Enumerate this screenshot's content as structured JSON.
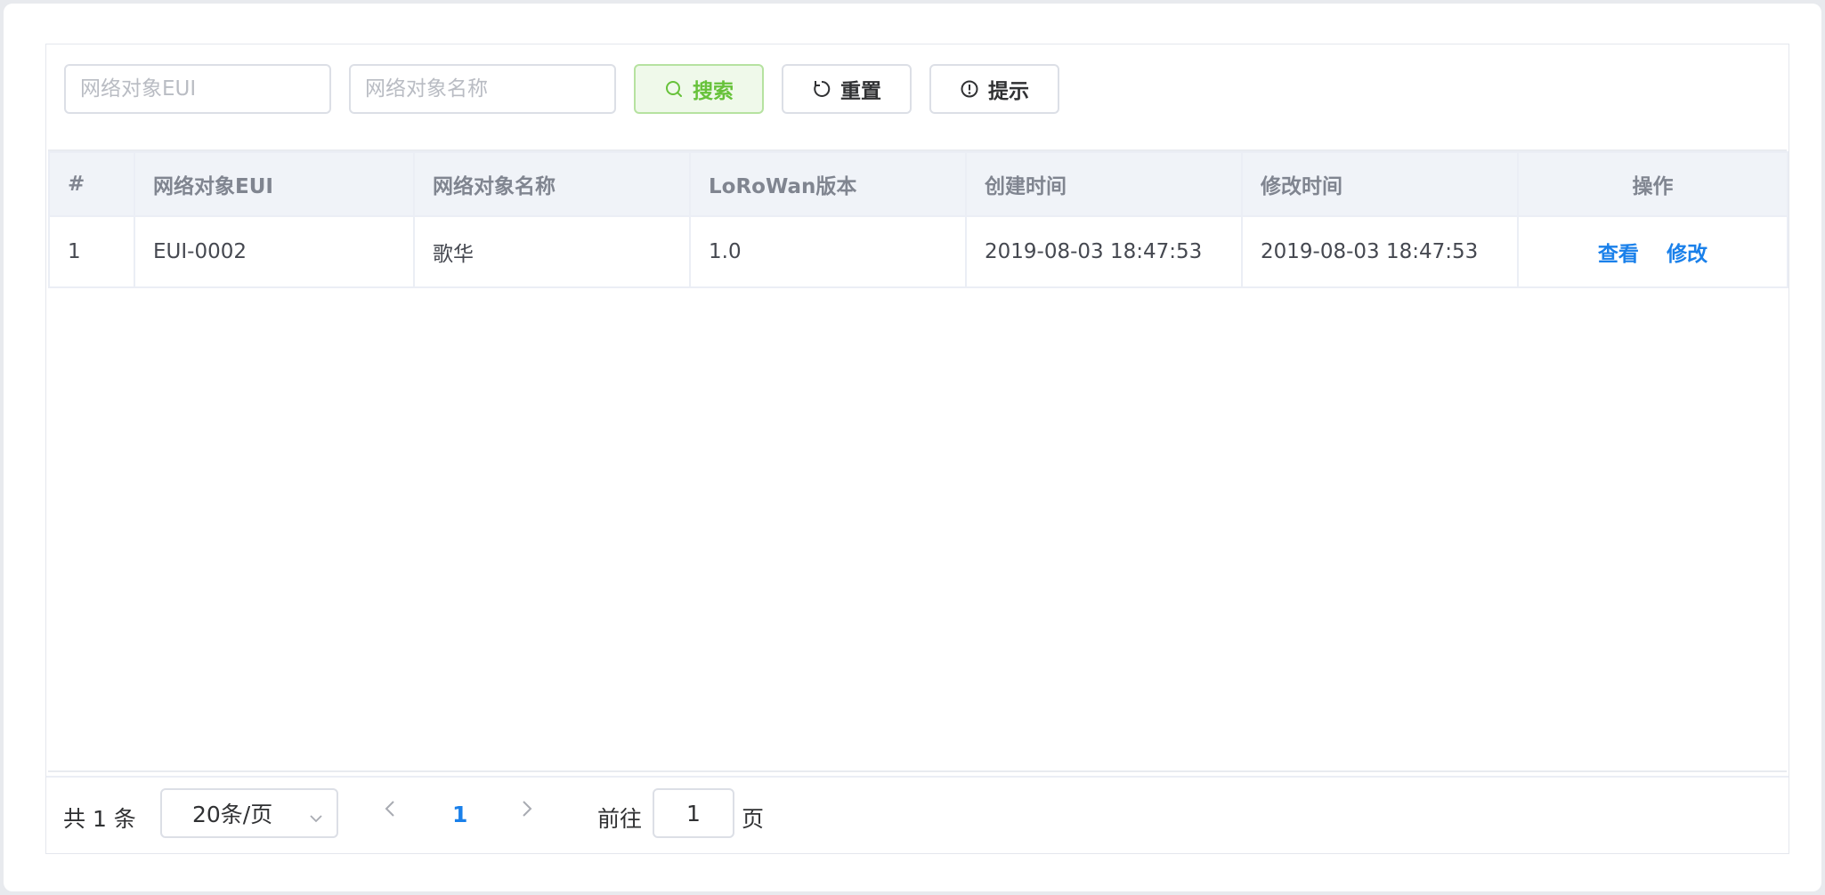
{
  "search": {
    "eui_placeholder": "网络对象EUI",
    "name_placeholder": "网络对象名称",
    "search_label": "搜索",
    "reset_label": "重置",
    "hint_label": "提示"
  },
  "table": {
    "headers": [
      "#",
      "网络对象EUI",
      "网络对象名称",
      "LoRoWan版本",
      "创建时间",
      "修改时间",
      "操作"
    ],
    "rows": [
      {
        "index": "1",
        "eui": "EUI-0002",
        "name": "歌华",
        "version": "1.0",
        "created": "2019-08-03 18:47:53",
        "modified": "2019-08-03 18:47:53",
        "view_label": "查看",
        "edit_label": "修改"
      }
    ]
  },
  "pagination": {
    "total": "共 1 条",
    "page_size": "20条/页",
    "current_page": "1",
    "goto_label": "前往",
    "goto_value": "1",
    "page_suffix": "页"
  },
  "colors": {
    "accent": "#1a80ea",
    "success": "#67c23a",
    "header_bg": "#f0f3f8",
    "border": "#dcdfe6"
  }
}
